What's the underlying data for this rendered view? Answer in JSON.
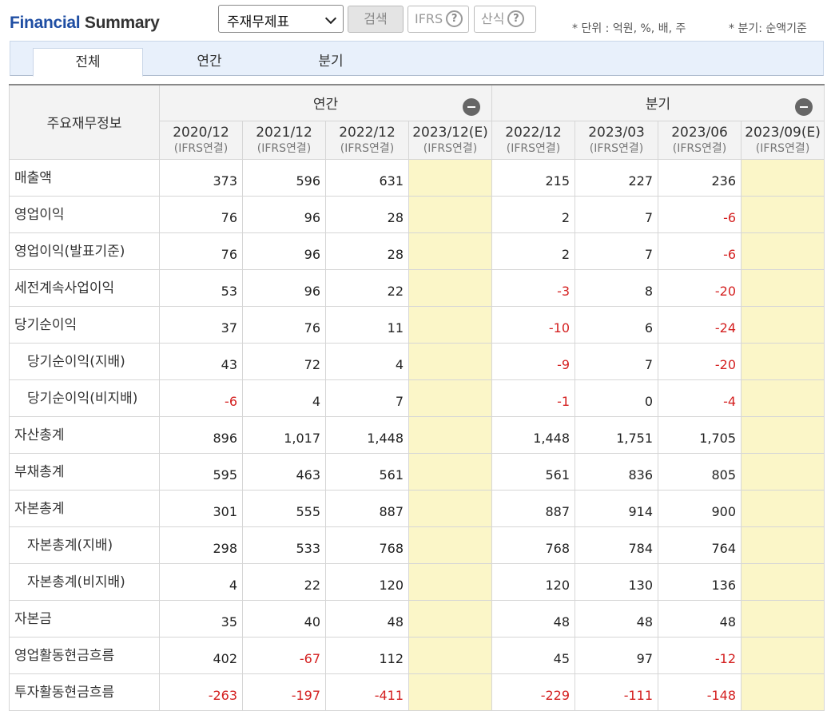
{
  "header": {
    "title_part1": "Financial",
    "title_part2": "Summary",
    "select_value": "주재무제표",
    "search_label": "검색",
    "ifrs_label": "IFRS",
    "formula_label": "산식",
    "help_glyph": "?",
    "unit_note": "* 단위 : 억원, %, 배, 주",
    "quarter_note": "* 분기: 순액기준"
  },
  "tabs": [
    {
      "label": "전체",
      "active": true
    },
    {
      "label": "연간",
      "active": false
    },
    {
      "label": "분기",
      "active": false
    }
  ],
  "table": {
    "corner_label": "주요재무정보",
    "groups": [
      {
        "label": "연간"
      },
      {
        "label": "분기"
      }
    ],
    "columns": [
      {
        "period": "2020/12",
        "basis": "(IFRS연결)",
        "estimate": false
      },
      {
        "period": "2021/12",
        "basis": "(IFRS연결)",
        "estimate": false
      },
      {
        "period": "2022/12",
        "basis": "(IFRS연결)",
        "estimate": false
      },
      {
        "period": "2023/12(E)",
        "basis": "(IFRS연결)",
        "estimate": true
      },
      {
        "period": "2022/12",
        "basis": "(IFRS연결)",
        "estimate": false
      },
      {
        "period": "2023/03",
        "basis": "(IFRS연결)",
        "estimate": false
      },
      {
        "period": "2023/06",
        "basis": "(IFRS연결)",
        "estimate": false
      },
      {
        "period": "2023/09(E)",
        "basis": "(IFRS연결)",
        "estimate": true
      }
    ],
    "rows": [
      {
        "label": "매출액",
        "indent": false,
        "values": [
          "373",
          "596",
          "631",
          "",
          "215",
          "227",
          "236",
          ""
        ]
      },
      {
        "label": "영업이익",
        "indent": false,
        "values": [
          "76",
          "96",
          "28",
          "",
          "2",
          "7",
          "-6",
          ""
        ]
      },
      {
        "label": "영업이익(발표기준)",
        "indent": false,
        "values": [
          "76",
          "96",
          "28",
          "",
          "2",
          "7",
          "-6",
          ""
        ]
      },
      {
        "label": "세전계속사업이익",
        "indent": false,
        "values": [
          "53",
          "96",
          "22",
          "",
          "-3",
          "8",
          "-20",
          ""
        ]
      },
      {
        "label": "당기순이익",
        "indent": false,
        "values": [
          "37",
          "76",
          "11",
          "",
          "-10",
          "6",
          "-24",
          ""
        ]
      },
      {
        "label": "당기순이익(지배)",
        "indent": true,
        "values": [
          "43",
          "72",
          "4",
          "",
          "-9",
          "7",
          "-20",
          ""
        ]
      },
      {
        "label": "당기순이익(비지배)",
        "indent": true,
        "values": [
          "-6",
          "4",
          "7",
          "",
          "-1",
          "0",
          "-4",
          ""
        ]
      },
      {
        "label": "자산총계",
        "indent": false,
        "values": [
          "896",
          "1,017",
          "1,448",
          "",
          "1,448",
          "1,751",
          "1,705",
          ""
        ]
      },
      {
        "label": "부채총계",
        "indent": false,
        "values": [
          "595",
          "463",
          "561",
          "",
          "561",
          "836",
          "805",
          ""
        ]
      },
      {
        "label": "자본총계",
        "indent": false,
        "values": [
          "301",
          "555",
          "887",
          "",
          "887",
          "914",
          "900",
          ""
        ]
      },
      {
        "label": "자본총계(지배)",
        "indent": true,
        "values": [
          "298",
          "533",
          "768",
          "",
          "768",
          "784",
          "764",
          ""
        ]
      },
      {
        "label": "자본총계(비지배)",
        "indent": true,
        "values": [
          "4",
          "22",
          "120",
          "",
          "120",
          "130",
          "136",
          ""
        ]
      },
      {
        "label": "자본금",
        "indent": false,
        "values": [
          "35",
          "40",
          "48",
          "",
          "48",
          "48",
          "48",
          ""
        ]
      },
      {
        "label": "영업활동현금흐름",
        "indent": false,
        "values": [
          "402",
          "-67",
          "112",
          "",
          "45",
          "97",
          "-12",
          ""
        ]
      },
      {
        "label": "투자활동현금흐름",
        "indent": false,
        "values": [
          "-263",
          "-197",
          "-411",
          "",
          "-229",
          "-111",
          "-148",
          ""
        ]
      }
    ]
  },
  "colors": {
    "brand_blue": "#1f4ea3",
    "negative_red": "#d42020",
    "estimate_bg": "#fbf6c8",
    "tabbar_bg": "#e8f0fb"
  }
}
